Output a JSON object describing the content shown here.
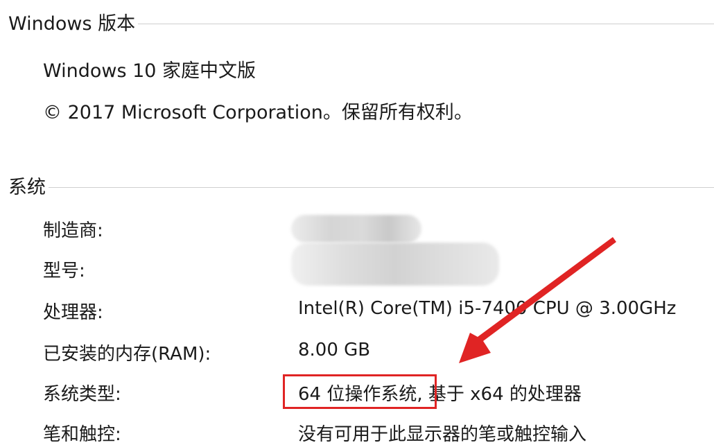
{
  "windows_section": {
    "title": "Windows 版本",
    "edition": "Windows 10 家庭中文版",
    "copyright": "© 2017 Microsoft Corporation。保留所有权利。"
  },
  "system_section": {
    "title": "系统",
    "rows": [
      {
        "label": "制造商:",
        "value": ""
      },
      {
        "label": "型号:",
        "value": ""
      },
      {
        "label": "处理器:",
        "value": "Intel(R) Core(TM) i5-7400 CPU @ 3.00GHz"
      },
      {
        "label": "已安装的内存(RAM):",
        "value": "8.00 GB"
      },
      {
        "label": "系统类型:",
        "value_highlight": "64 位操作系统",
        "value_rest": ", 基于 x64 的处理器"
      },
      {
        "label": "笔和触控:",
        "value": "没有可用于此显示器的笔或触控输入"
      }
    ]
  },
  "annotation": {
    "box_color": "#e02424",
    "arrow_color": "#e02424"
  }
}
